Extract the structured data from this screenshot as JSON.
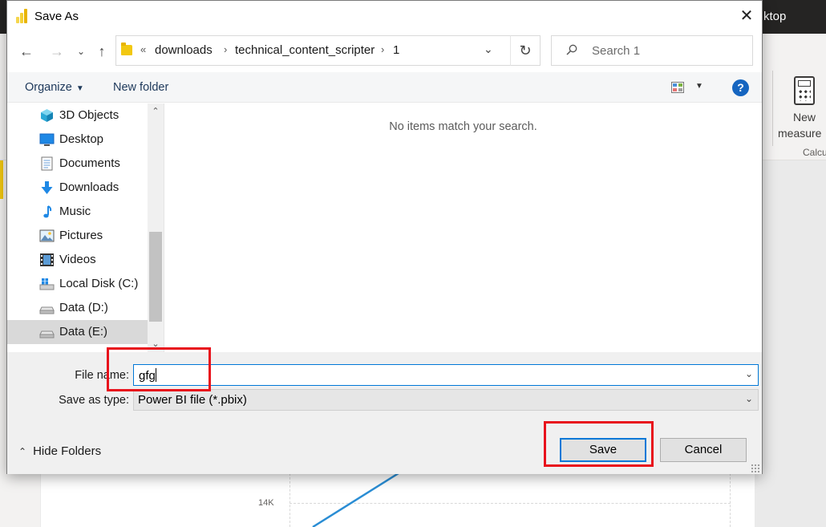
{
  "background_app": {
    "title_fragment": "ktop",
    "ribbon": {
      "new_measure_line1": "New",
      "new_measure_line2": "measure",
      "group_label": "Calcu"
    },
    "chart": {
      "y_tick_label": "14K",
      "line_color": "#2a8dd4"
    }
  },
  "dialog": {
    "title": "Save As",
    "close_icon": "close-icon",
    "nav": {
      "back": "←",
      "forward": "→",
      "recent": "⌄",
      "up": "↑"
    },
    "address": {
      "prefix": "«",
      "crumbs": [
        "downloads",
        "technical_content_scripter",
        "1"
      ],
      "separator": "›"
    },
    "search": {
      "placeholder": "Search 1"
    },
    "toolbar": {
      "organize": "Organize",
      "new_folder": "New folder",
      "help": "?"
    },
    "sidebar": {
      "items": [
        {
          "label": "3D Objects",
          "icon": "3d-objects-icon",
          "selected": false
        },
        {
          "label": "Desktop",
          "icon": "desktop-icon",
          "selected": false
        },
        {
          "label": "Documents",
          "icon": "documents-icon",
          "selected": false
        },
        {
          "label": "Downloads",
          "icon": "downloads-icon",
          "selected": false
        },
        {
          "label": "Music",
          "icon": "music-icon",
          "selected": false
        },
        {
          "label": "Pictures",
          "icon": "pictures-icon",
          "selected": false
        },
        {
          "label": "Videos",
          "icon": "videos-icon",
          "selected": false
        },
        {
          "label": "Local Disk (C:)",
          "icon": "local-disk-icon",
          "selected": false
        },
        {
          "label": "Data (D:)",
          "icon": "drive-icon",
          "selected": false
        },
        {
          "label": "Data (E:)",
          "icon": "drive-icon",
          "selected": true
        }
      ]
    },
    "content": {
      "empty_message": "No items match your search."
    },
    "form": {
      "file_name_label": "File name:",
      "file_name_value": "gfg",
      "save_as_type_label": "Save as type:",
      "save_as_type_value": "Power BI file (*.pbix)"
    },
    "footer": {
      "hide_folders": "Hide Folders",
      "save": "Save",
      "cancel": "Cancel"
    }
  },
  "colors": {
    "accent": "#0078d7",
    "highlight": "#e8111c",
    "powerbi_yellow": "#f2c811",
    "help_blue": "#1565c0"
  }
}
